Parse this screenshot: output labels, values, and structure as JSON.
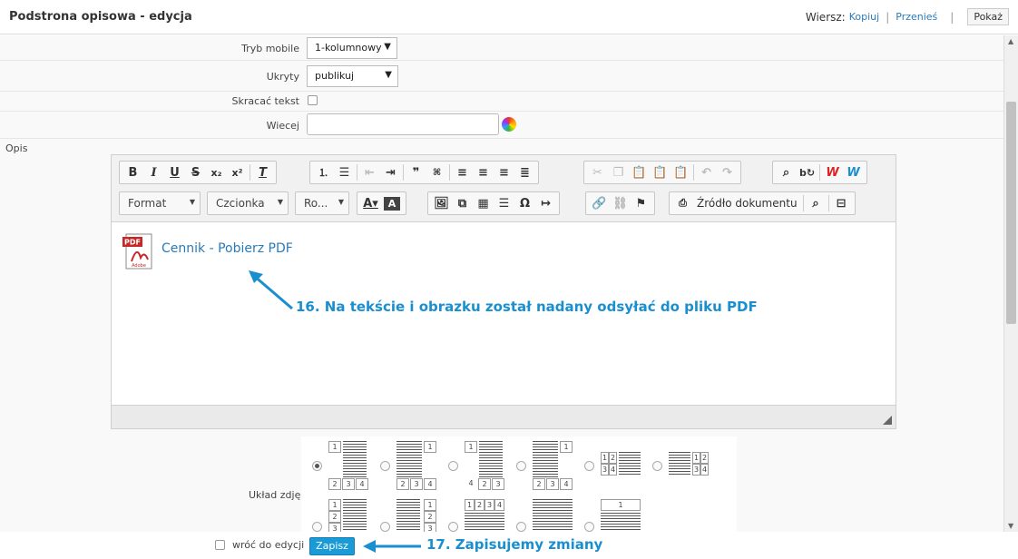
{
  "header": {
    "title": "Podstrona opisowa - edycja",
    "row_label": "Wiersz:",
    "copy_link": "Kopiuj",
    "move_link": "Przenieś",
    "show_button": "Pokaż"
  },
  "form": {
    "mobile_mode": {
      "label": "Tryb mobile",
      "value": "1-kolumnowy"
    },
    "hidden": {
      "label": "Ukryty",
      "value": "publikuj"
    },
    "shorten_text": {
      "label": "Skracać tekst",
      "checked": false
    },
    "more": {
      "label": "Wiecej",
      "value": ""
    },
    "description": {
      "label": "Opis"
    },
    "photo_layout": {
      "label": "Układ zdjęć",
      "selected_index": 0
    }
  },
  "editor": {
    "combos": {
      "format": "Format",
      "font": "Czcionka",
      "size": "Ro..."
    },
    "source_button": "Źródło dokumentu",
    "pdf_badge": "PDF",
    "pdf_brand": "Adobe",
    "link_text": "Cennik - Pobierz PDF"
  },
  "layout_thumbs": [
    "1",
    "2",
    "3",
    "4"
  ],
  "annotations": {
    "a16": "16. Na tekście i obrazku został nadany odsyłać do pliku PDF",
    "a17": "17. Zapisujemy zmiany"
  },
  "bottom": {
    "return_label": "wróć do edycji",
    "save_button": "Zapisz"
  },
  "colors": {
    "accent": "#1a9ad6",
    "link": "#2a7ab8",
    "annotation": "#1a8fd0"
  }
}
